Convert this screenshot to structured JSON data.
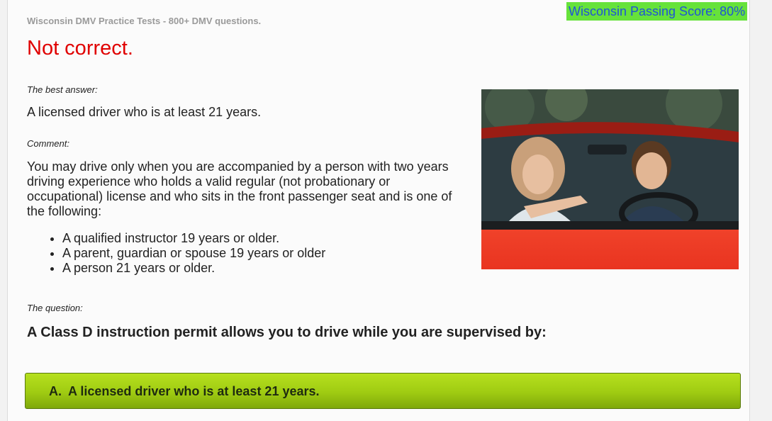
{
  "header": {
    "site_title": "Wisconsin DMV Practice Tests - 800+ DMV questions.",
    "passing_score": "Wisconsin Passing Score: 80%"
  },
  "result": {
    "heading": "Not correct.",
    "heading_color": "#e00000"
  },
  "best_answer": {
    "label": "The best answer:",
    "text": "A licensed driver who is at least 21 years."
  },
  "comment": {
    "label": "Comment:",
    "text": "You may drive only when you are accompanied by a person with two years driving experience who holds a valid regular (not probationary or occupational) license and who sits in the front passenger seat and is one of the following:",
    "list": [
      "A qualified instructor 19 years or older.",
      "A parent, guardian or spouse 19 years or older",
      "A person 21 years or older."
    ]
  },
  "question": {
    "label": "The question:",
    "text": "A Class D instruction permit allows you to drive while you are supervised by:"
  },
  "answer_option": {
    "letter": "A.",
    "text": "A licensed driver who is at least 21 years.",
    "color": "#9fcb12"
  },
  "colors": {
    "badge_bg": "#66e23a",
    "badge_text": "#1f54d6"
  }
}
